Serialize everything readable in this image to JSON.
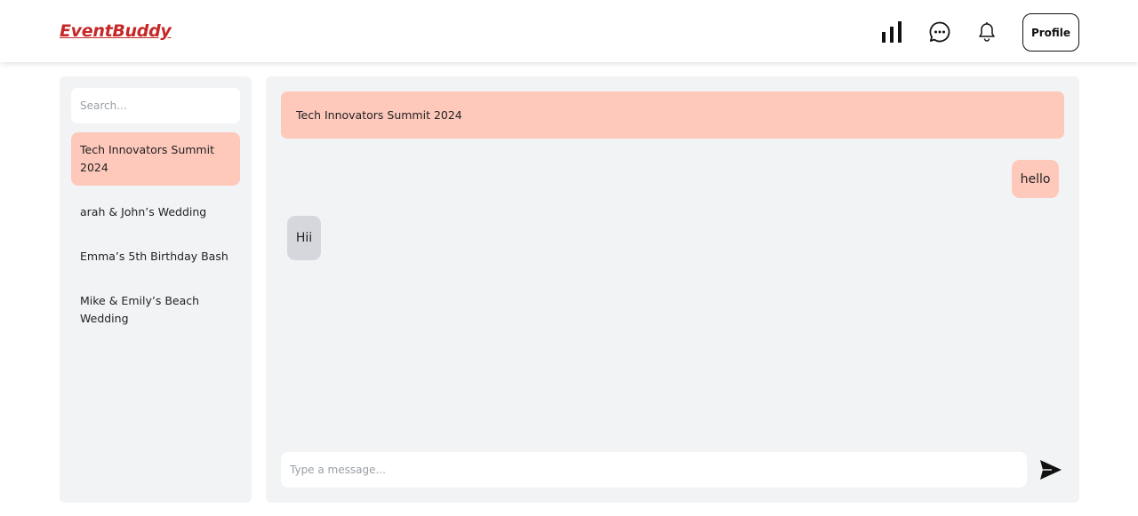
{
  "app": {
    "logo": "EventBuddy",
    "brand_color": "#c62828",
    "accent_color": "#fec8bb"
  },
  "nav": {
    "icons": [
      "bar-chart-icon",
      "chat-bubble-icon",
      "bell-icon"
    ],
    "profile_label": "Profile"
  },
  "sidebar": {
    "search_placeholder": "Search...",
    "conversations": [
      {
        "label": "Tech Innovators Summit 2024",
        "active": true
      },
      {
        "label": "arah & John’s Wedding",
        "active": false
      },
      {
        "label": "Emma’s 5th Birthday Bash",
        "active": false
      },
      {
        "label": "Mike & Emily’s Beach Wedding",
        "active": false
      }
    ]
  },
  "chat": {
    "title": "Tech Innovators Summit 2024",
    "messages": [
      {
        "text": "hello",
        "direction": "outgoing"
      },
      {
        "text": "Hii",
        "direction": "incoming"
      }
    ],
    "composer_placeholder": "Type a message...",
    "send_icon": "send-icon"
  }
}
